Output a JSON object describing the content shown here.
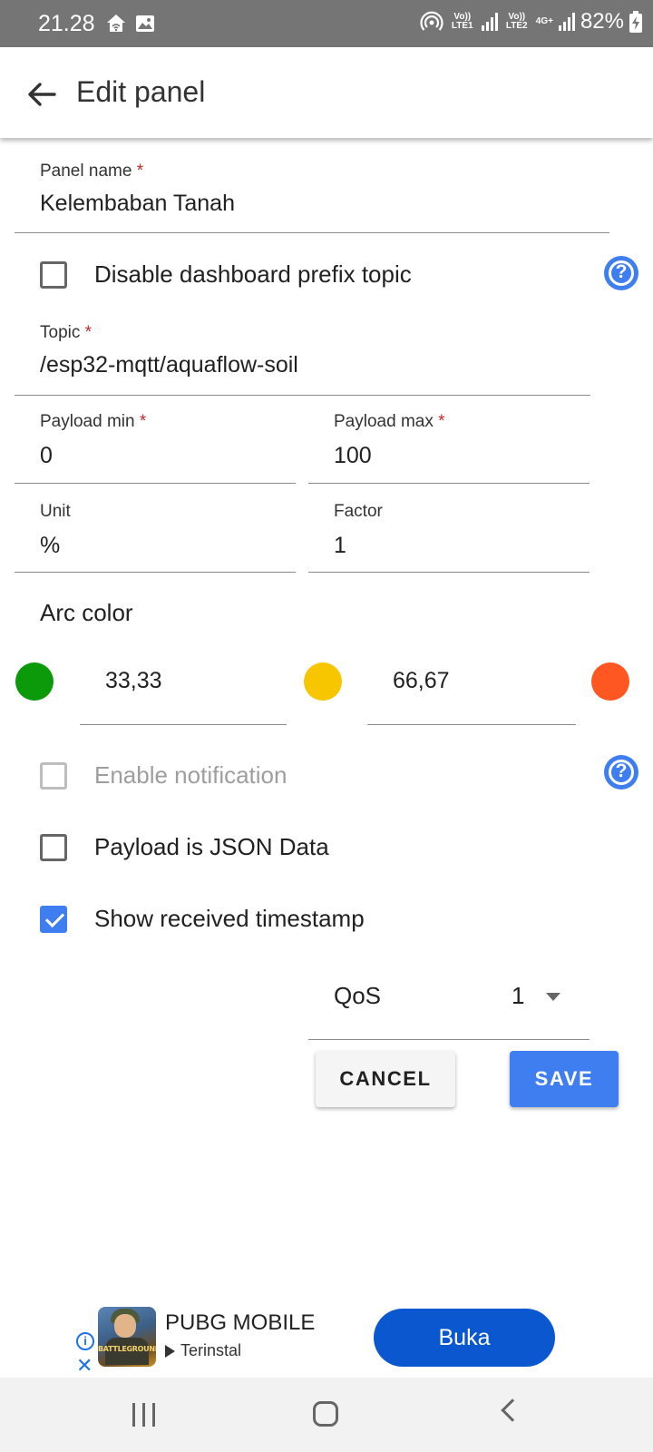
{
  "status_bar": {
    "time": "21.28",
    "sim1_label": "Vo)) LTE1",
    "sim2_label": "Vo)) LTE2",
    "net_type": "4G+",
    "battery": "82%"
  },
  "app_bar": {
    "title": "Edit panel"
  },
  "form": {
    "panel_name": {
      "label": "Panel name",
      "required": "*",
      "value": "Kelembaban Tanah"
    },
    "disable_prefix": {
      "label": "Disable dashboard prefix topic",
      "checked": false
    },
    "topic": {
      "label": "Topic",
      "required": "*",
      "value": "/esp32-mqtt/aquaflow-soil"
    },
    "payload_min": {
      "label": "Payload min",
      "required": "*",
      "value": "0"
    },
    "payload_max": {
      "label": "Payload max",
      "required": "*",
      "value": "100"
    },
    "unit": {
      "label": "Unit",
      "value": "%"
    },
    "factor": {
      "label": "Factor",
      "value": "1"
    },
    "arc_color": {
      "title": "Arc color",
      "colors": [
        "#0a9a0a",
        "#f7c600",
        "#ff5722"
      ],
      "threshold1": "33,33",
      "threshold2": "66,67"
    },
    "enable_notification": {
      "label": "Enable notification",
      "checked": false,
      "disabled": true
    },
    "payload_json": {
      "label": "Payload is JSON Data",
      "checked": false
    },
    "show_timestamp": {
      "label": "Show received timestamp",
      "checked": true
    },
    "qos": {
      "label": "QoS",
      "value": "1"
    }
  },
  "help_icon": "?",
  "buttons": {
    "cancel": "CANCEL",
    "save": "SAVE"
  },
  "ad": {
    "title": "PUBG MOBILE",
    "subtitle": "Terinstal",
    "cta": "Buka",
    "info": "i",
    "close": "✕",
    "logo_text": "BATTLEGROUNDS"
  }
}
